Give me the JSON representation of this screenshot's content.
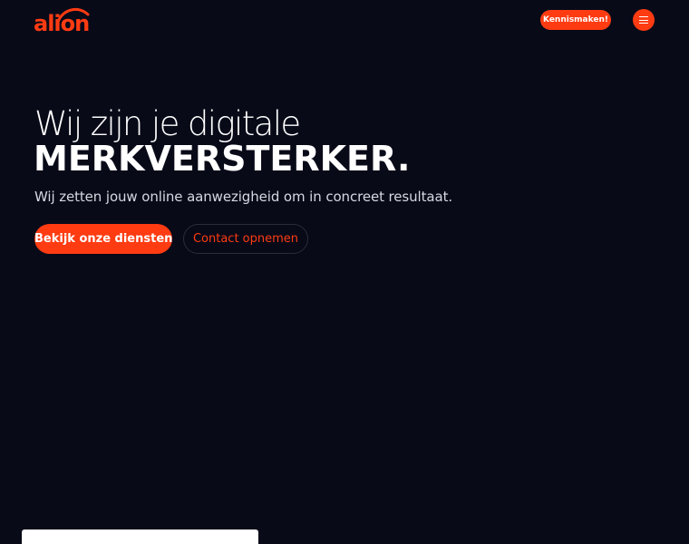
{
  "header": {
    "logo_text": "alion",
    "cta_label": "Kennismaken!",
    "menu_icon": "hamburger-icon"
  },
  "hero": {
    "line1": "Wij zijn je digitale",
    "line2": "MERKVERSTERKER.",
    "subtitle": "Wij zetten jouw online aanwezigheid om in concreet resultaat.",
    "primary_button": "Bekijk onze diensten",
    "secondary_button": "Contact opnemen"
  },
  "bottom_card": {
    "text": ""
  },
  "colors": {
    "background": "#080a18",
    "accent": "#ff3b12",
    "text": "#ffffff"
  }
}
